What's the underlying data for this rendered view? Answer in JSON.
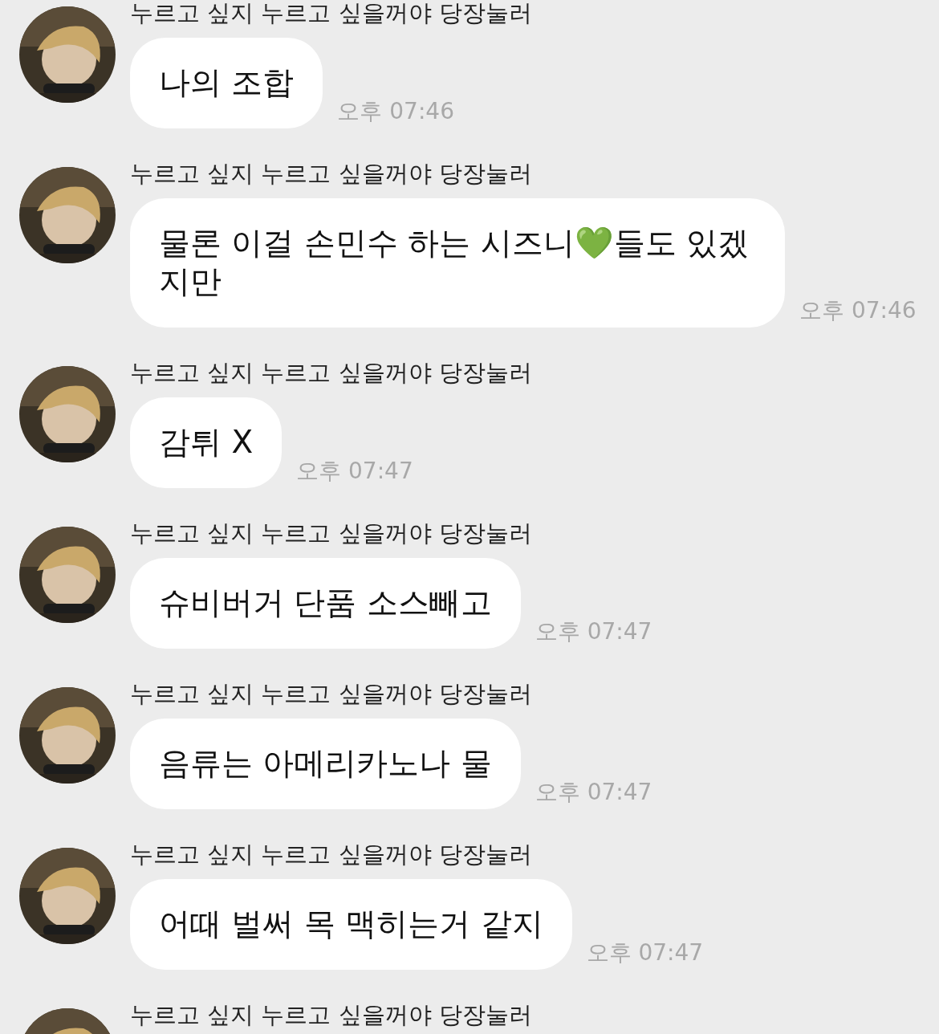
{
  "messages": [
    {
      "sender": "누르고 싶지 누르고 싶을꺼야 당장눌러",
      "text": "나의 조합",
      "time": "오후 07:46"
    },
    {
      "sender": "누르고 싶지 누르고 싶을꺼야 당장눌러",
      "text": "물론 이걸 손민수 하는 시즈니💚들도 있겠지만",
      "time": "오후 07:46"
    },
    {
      "sender": "누르고 싶지 누르고 싶을꺼야 당장눌러",
      "text": "감튀 X",
      "time": "오후 07:47"
    },
    {
      "sender": "누르고 싶지 누르고 싶을꺼야 당장눌러",
      "text": "슈비버거 단품 소스빼고",
      "time": "오후 07:47"
    },
    {
      "sender": "누르고 싶지 누르고 싶을꺼야 당장눌러",
      "text": "음류는 아메리카노나 물",
      "time": "오후 07:47"
    },
    {
      "sender": "누르고 싶지 누르고 싶을꺼야 당장눌러",
      "text": "어때 벌써 목 맥히는거 같지",
      "time": "오후 07:47"
    },
    {
      "sender": "누르고 싶지 누르고 싶을꺼야 당장눌러"
    }
  ]
}
